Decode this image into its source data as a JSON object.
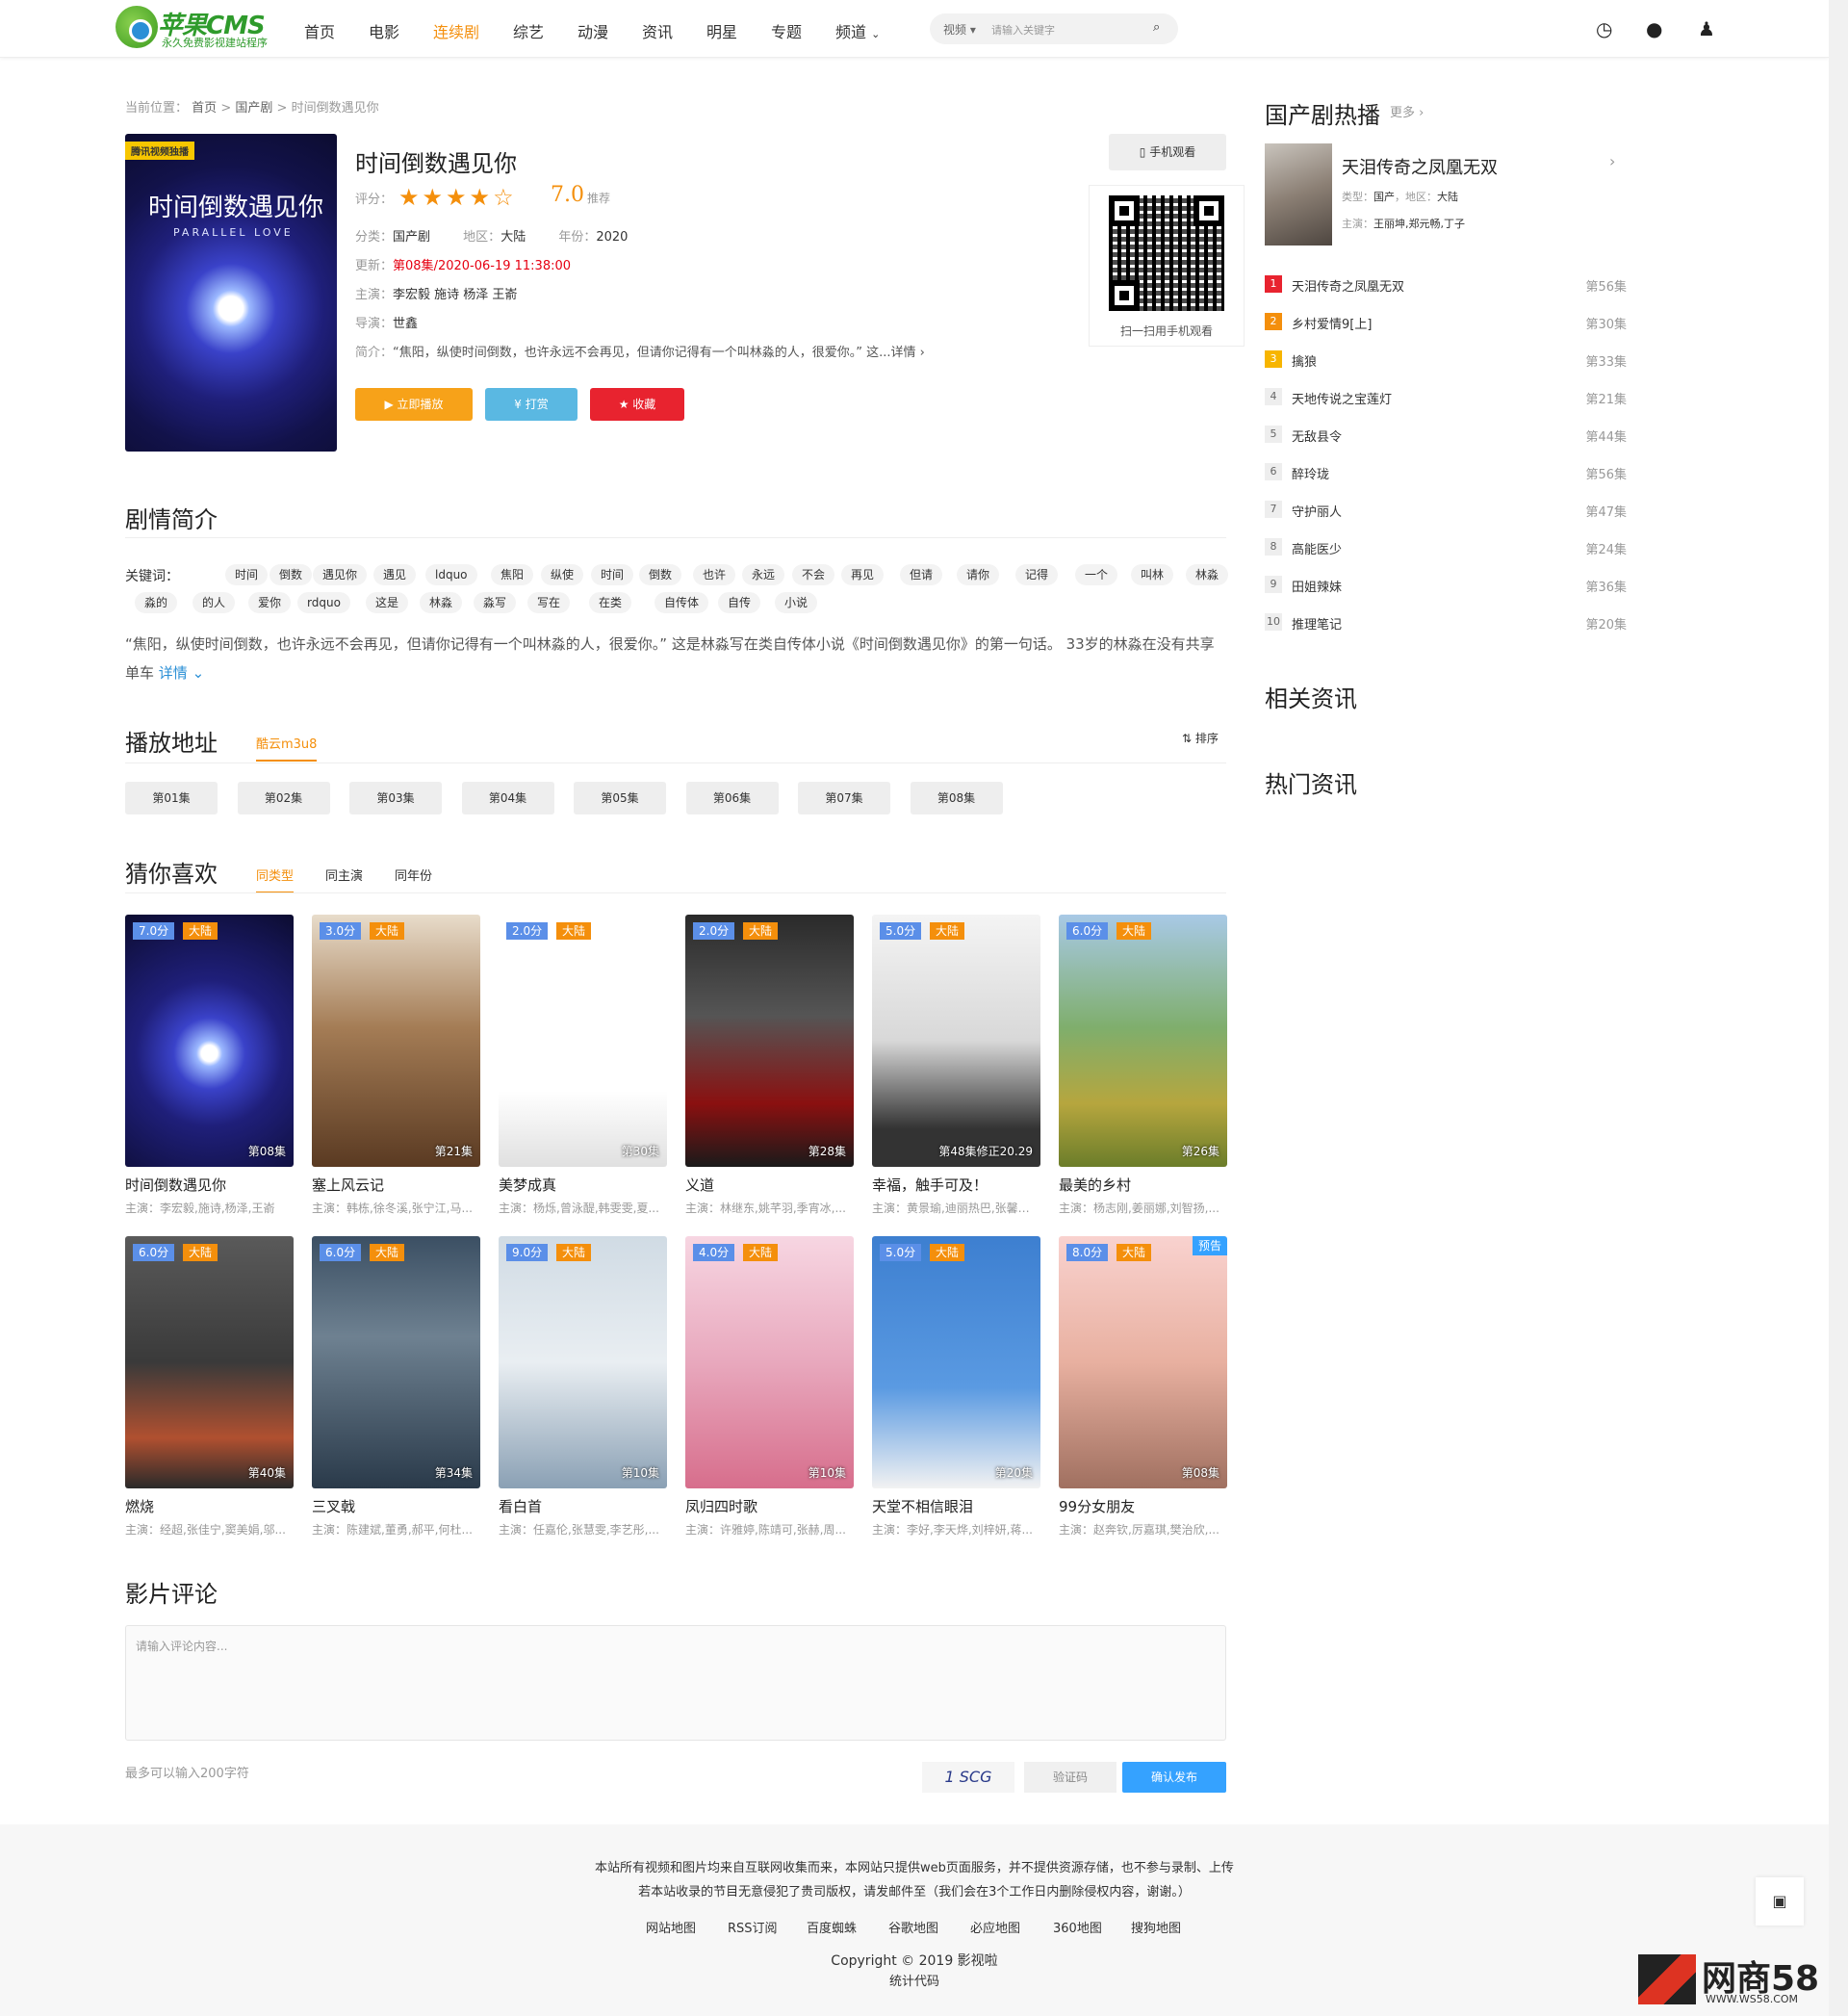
{
  "logo": {
    "name": "苹果CMS",
    "slogan": "永久免费影视建站程序"
  },
  "nav": [
    "首页",
    "电影",
    "连续剧",
    "综艺",
    "动漫",
    "资讯",
    "明星",
    "专题",
    "频道"
  ],
  "nav_active": "连续剧",
  "search": {
    "type": "视频",
    "placeholder": "请输入关键字"
  },
  "breadcrumb": {
    "label": "当前位置：",
    "home": "首页",
    "sep": ">",
    "cat": "国产剧",
    "cur": "时间倒数遇见你"
  },
  "detail": {
    "poster_badge": "腾讯视频独播",
    "poster_title": "时间倒数遇见你",
    "poster_sub": "PARALLEL LOVE",
    "title": "时间倒数遇见你",
    "rating_label": "评分：",
    "rating_stars": 4,
    "score": "7.0",
    "rec": "推荐",
    "cat_label": "分类：",
    "cat": "国产剧",
    "area_label": "地区：",
    "area": "大陆",
    "year_label": "年份：",
    "year": "2020",
    "update_label": "更新：",
    "update_ep": "第08集",
    "update_time": "/2020-06-19 11:38:00",
    "actor_label": "主演：",
    "actors": "李宏毅 施诗 杨泽 王嵛",
    "director_label": "导演：",
    "director": "世鑫",
    "intro_label": "简介：",
    "intro": "“焦阳，纵使时间倒数，也许永远不会再见，但请你记得有一个叫林淼的人，很爱你。” 这...详情 ›",
    "btn_play": "▶ 立即播放",
    "btn_tip": "¥ 打赏",
    "btn_fav": "★ 收藏",
    "mobile": "手机观看",
    "qr_text": "扫一扫用手机观看"
  },
  "plot": {
    "title": "剧情简介",
    "kw_label": "关键词：",
    "keywords": [
      "时间",
      "倒数",
      "遇见你",
      "遇见",
      "ldquo",
      "焦阳",
      "纵使",
      "时间",
      "倒数",
      "也许",
      "永远",
      "不会",
      "再见",
      "但请",
      "请你",
      "记得",
      "一个",
      "叫林",
      "林淼",
      "淼的",
      "的人",
      "爱你",
      "rdquo",
      "这是",
      "林淼",
      "淼写",
      "写在",
      "在类",
      "自传体",
      "自传",
      "小说"
    ],
    "desc": "“焦阳，纵使时间倒数，也许永远不会再见，但请你记得有一个叫林淼的人，很爱你。” 这是林淼写在类自传体小说《时间倒数遇见你》的第一句话。 33岁的林淼在没有共享单车",
    "more": "详情"
  },
  "play": {
    "title": "播放地址",
    "source": "酷云m3u8",
    "sort": "排序",
    "episodes": [
      "第01集",
      "第02集",
      "第03集",
      "第04集",
      "第05集",
      "第06集",
      "第07集",
      "第08集"
    ]
  },
  "like": {
    "title": "猜你喜欢",
    "tabs": [
      "同类型",
      "同主演",
      "同年份"
    ],
    "cards": [
      {
        "name": "时间倒数遇见你",
        "score": "7.0分",
        "area": "大陆",
        "ep": "第08集",
        "actors": "主演：李宏毅,施诗,杨泽,王嵛",
        "pv": ""
      },
      {
        "name": "塞上风云记",
        "score": "3.0分",
        "area": "大陆",
        "ep": "第21集",
        "actors": "主演：韩栋,徐冬溪,张宁江,马...",
        "pv": ""
      },
      {
        "name": "美梦成真",
        "score": "2.0分",
        "area": "大陆",
        "ep": "第30集",
        "actors": "主演：杨烁,曾泳醍,韩雯雯,夏...",
        "pv": ""
      },
      {
        "name": "义道",
        "score": "2.0分",
        "area": "大陆",
        "ep": "第28集",
        "actors": "主演：林继东,姚芊羽,季宵冰,...",
        "pv": ""
      },
      {
        "name": "幸福，触手可及！",
        "score": "5.0分",
        "area": "大陆",
        "ep": "第48集修正20.29",
        "actors": "主演：黄景瑜,迪丽热巴,张馨予...",
        "pv": ""
      },
      {
        "name": "最美的乡村",
        "score": "6.0分",
        "area": "大陆",
        "ep": "第26集",
        "actors": "主演：杨志刚,姜丽娜,刘智扬,...",
        "pv": ""
      },
      {
        "name": "燃烧",
        "score": "6.0分",
        "area": "大陆",
        "ep": "第40集",
        "actors": "主演：经超,张佳宁,窦美娟,邬...",
        "pv": ""
      },
      {
        "name": "三叉戟",
        "score": "6.0分",
        "area": "大陆",
        "ep": "第34集",
        "actors": "主演：陈建斌,董勇,郝平,何杜...",
        "pv": ""
      },
      {
        "name": "看白首",
        "score": "9.0分",
        "area": "大陆",
        "ep": "第10集",
        "actors": "主演：任嘉伦,张慧雯,李艺彤,...",
        "pv": ""
      },
      {
        "name": "凤归四时歌",
        "score": "4.0分",
        "area": "大陆",
        "ep": "第10集",
        "actors": "主演：许雅婷,陈靖可,张赫,周...",
        "pv": ""
      },
      {
        "name": "天堂不相信眼泪",
        "score": "5.0分",
        "area": "大陆",
        "ep": "第20集",
        "actors": "主演：李好,李天烨,刘梓妍,蒋...",
        "pv": ""
      },
      {
        "name": "99分女朋友",
        "score": "8.0分",
        "area": "大陆",
        "ep": "第08集",
        "actors": "主演：赵奔钦,厉嘉琪,樊治欣,...",
        "pv": "预告"
      }
    ]
  },
  "comment": {
    "title": "影片评论",
    "placeholder": "请输入评论内容...",
    "limit": "最多可以输入200字符",
    "captcha": "1 SCG",
    "verify_ph": "验证码",
    "submit": "确认发布"
  },
  "sidebar": {
    "hot_title": "国产剧热播",
    "more": "更多 ›",
    "top": {
      "name": "天泪传奇之凤凰无双",
      "type_label": "类型：",
      "type": "国产",
      "area_label": "，地区：",
      "area": "大陆",
      "actor_label": "主演：",
      "actors": "王丽坤,郑元畅,丁子"
    },
    "list": [
      {
        "n": "1",
        "t": "天泪传奇之凤凰无双",
        "e": "第56集"
      },
      {
        "n": "2",
        "t": "乡村爱情9[上]",
        "e": "第30集"
      },
      {
        "n": "3",
        "t": "擒狼",
        "e": "第33集"
      },
      {
        "n": "4",
        "t": "天地传说之宝莲灯",
        "e": "第21集"
      },
      {
        "n": "5",
        "t": "无敌县令",
        "e": "第44集"
      },
      {
        "n": "6",
        "t": "醉玲珑",
        "e": "第56集"
      },
      {
        "n": "7",
        "t": "守护丽人",
        "e": "第47集"
      },
      {
        "n": "8",
        "t": "高能医少",
        "e": "第24集"
      },
      {
        "n": "9",
        "t": "田姐辣妹",
        "e": "第36集"
      },
      {
        "n": "10",
        "t": "推理笔记",
        "e": "第20集"
      }
    ],
    "news_title": "相关资讯",
    "hot_news_title": "热门资讯"
  },
  "footer": {
    "line1": "本站所有视频和图片均来自互联网收集而来，本网站只提供web页面服务，并不提供资源存储，也不参与录制、上传",
    "line2": "若本站收录的节目无意侵犯了贵司版权，请发邮件至（我们会在3个工作日内删除侵权内容，谢谢。）",
    "links": [
      "网站地图",
      "RSS订阅",
      "百度蜘蛛",
      "谷歌地图",
      "必应地图",
      "360地图",
      "搜狗地图"
    ],
    "copyright": "Copyright © 2019 影视啦",
    "stat": "统计代码",
    "watermark": "网商58",
    "watermark_url": "WWW.WS58.COM"
  },
  "colors": {
    "accent": "#f48f0c",
    "blue": "#35a2ff",
    "red": "#e60012"
  }
}
